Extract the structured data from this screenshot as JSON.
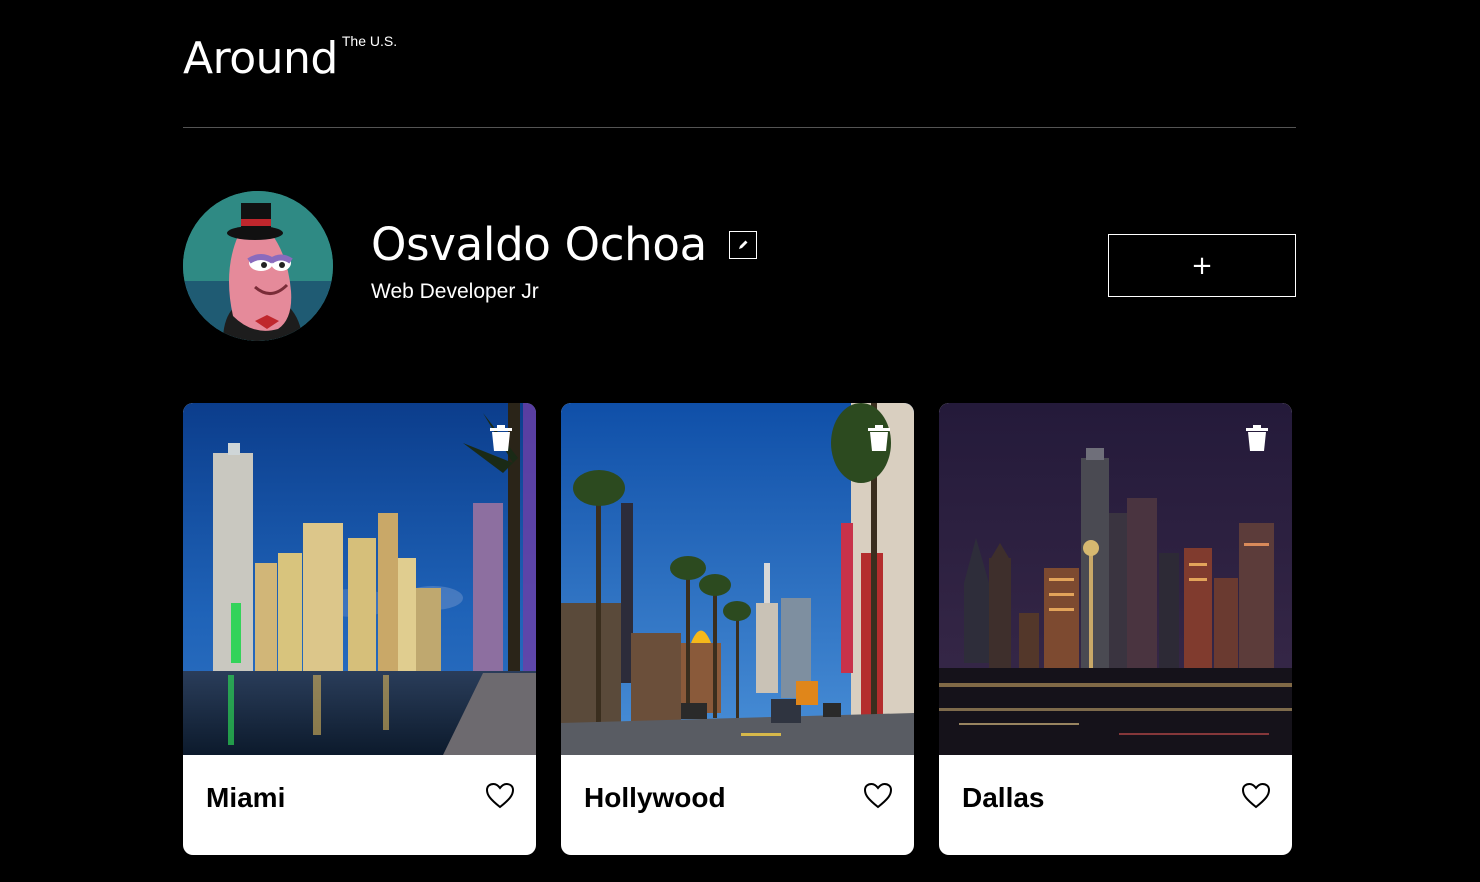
{
  "header": {
    "logo_main": "Around",
    "logo_sup": "The U.S."
  },
  "profile": {
    "name": "Osvaldo Ochoa",
    "job": "Web Developer Jr",
    "add_label": "+"
  },
  "cards": [
    {
      "title": "Miami",
      "image": "miami-skyline-night"
    },
    {
      "title": "Hollywood",
      "image": "hollywood-boulevard-day"
    },
    {
      "title": "Dallas",
      "image": "dallas-skyline-night"
    }
  ],
  "colors": {
    "background": "#000000",
    "card": "#ffffff",
    "text_light": "#ffffff",
    "text_dark": "#000000",
    "divider": "#545454"
  }
}
